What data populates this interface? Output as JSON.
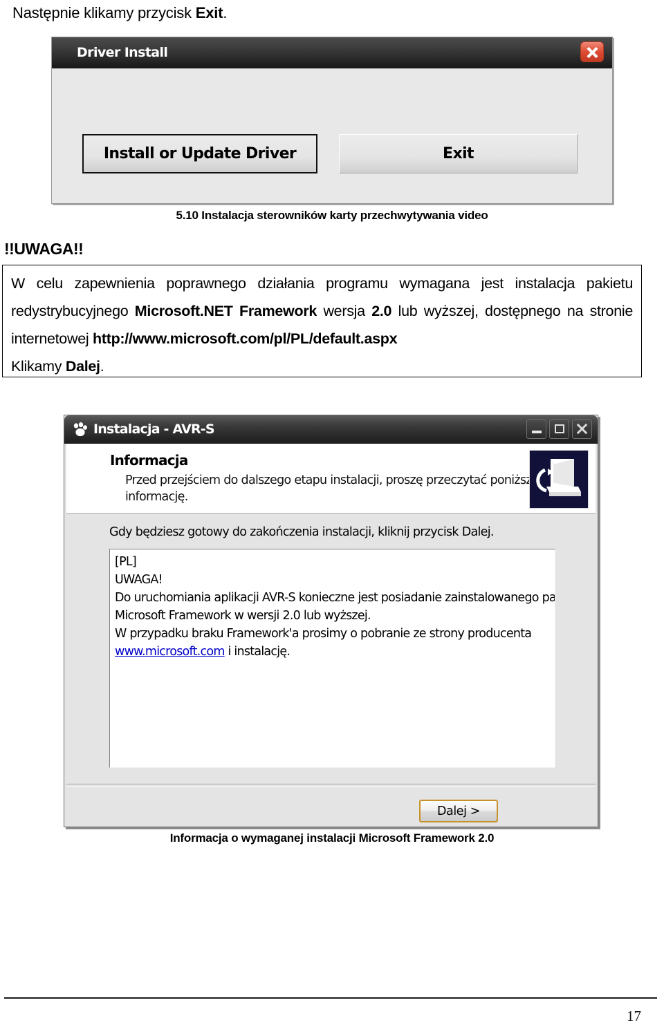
{
  "document": {
    "intro_text_prefix": "Następnie klikamy przycisk ",
    "intro_text_bold": "Exit",
    "intro_text_suffix": ".",
    "page_number": "17",
    "caption_1": "5.10 Instalacja sterowników karty przechwytywania video",
    "caption_2": "Informacja o wymaganej instalacji Microsoft Framework 2.0",
    "uwaga_label": "!!UWAGA!!"
  },
  "note": {
    "line1_a": "W celu zapewnienia poprawnego działania programu wymagana jest instalacja pakietu redystrybucyjnego ",
    "line1_b": "Microsoft.NET Framework",
    "line1_c": " wersja ",
    "line1_d": "2.0",
    "line1_e": " lub wyższej, dostępnego na stronie internetowej ",
    "line1_f": "http://www.microsoft.com/pl/PL/default.aspx",
    "line2_a": "Klikamy ",
    "line2_b": "Dalej",
    "line2_c": "."
  },
  "driver_dialog": {
    "title": "Driver Install",
    "close_icon": "close-x-icon",
    "buttons": {
      "install": "Install or Update Driver",
      "exit": "Exit"
    }
  },
  "installer": {
    "title": "Instalacja - AVR-S",
    "app_icon": "paw-print-icon",
    "window_buttons": {
      "minimize": "minimize-icon",
      "maximize": "maximize-icon",
      "close": "close-icon"
    },
    "header": {
      "heading": "Informacja",
      "subtext": "Przed przejściem do dalszego etapu instalacji, proszę przeczytać poniższą informację.",
      "icon": "computer-monitor-icon"
    },
    "prompt": "Gdy będziesz gotowy do zakończenia instalacji, kliknij przycisk Dalej.",
    "memo_lines": [
      "[PL]",
      "UWAGA!",
      "Do uruchomiania aplikacji AVR-S konieczne jest posiadanie zainstalowanego pakietu",
      "Microsoft Framework w wersji 2.0 lub wyższej.",
      "W przypadku braku Framework'a prosimy o pobranie ze strony producenta"
    ],
    "memo_link": "www.microsoft.com",
    "memo_link_tail": " i instalację.",
    "next_button": "Dalej >"
  },
  "colors": {
    "dialog_face": "#e8e8e8",
    "titlebar_dark": "#1c1c1c",
    "close_red": "#de4b32",
    "next_border_gold": "#c8922a",
    "link_blue": "#0000c8",
    "icon_navy": "#11113a"
  }
}
